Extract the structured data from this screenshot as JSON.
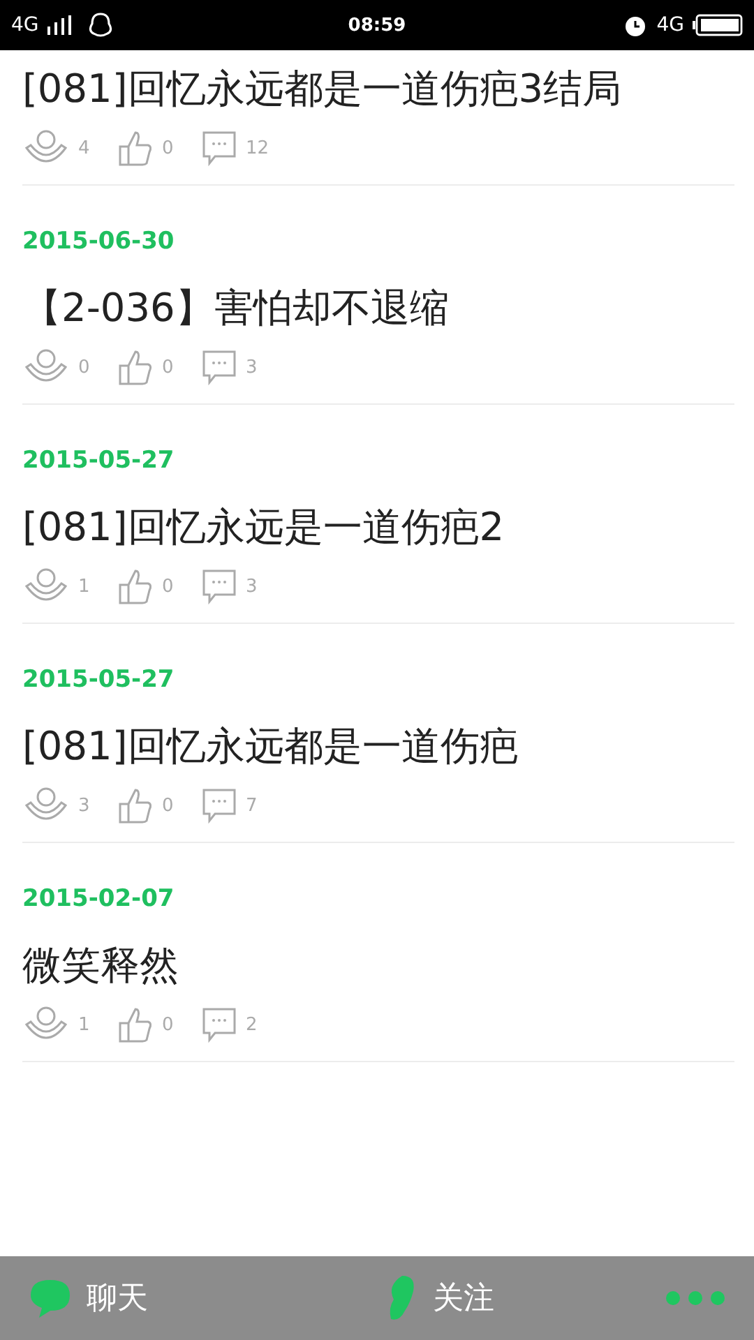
{
  "status_bar": {
    "network": "4G",
    "time": "08:59",
    "network_right": "4G"
  },
  "posts": [
    {
      "title": "[081]回忆永远都是一道伤疤3结局",
      "views": "4",
      "likes": "0",
      "comments": "12"
    },
    {
      "date": "2015-06-30",
      "title": "【2-036】害怕却不退缩",
      "views": "0",
      "likes": "0",
      "comments": "3"
    },
    {
      "date": "2015-05-27",
      "title": "[081]回忆永远是一道伤疤2",
      "views": "1",
      "likes": "0",
      "comments": "3"
    },
    {
      "date": "2015-05-27",
      "title": "[081]回忆永远都是一道伤疤",
      "views": "3",
      "likes": "0",
      "comments": "7"
    },
    {
      "date": "2015-02-07",
      "title": "微笑释然",
      "views": "1",
      "likes": "0",
      "comments": "2"
    }
  ],
  "bottom_bar": {
    "chat": "聊天",
    "follow": "关注"
  }
}
